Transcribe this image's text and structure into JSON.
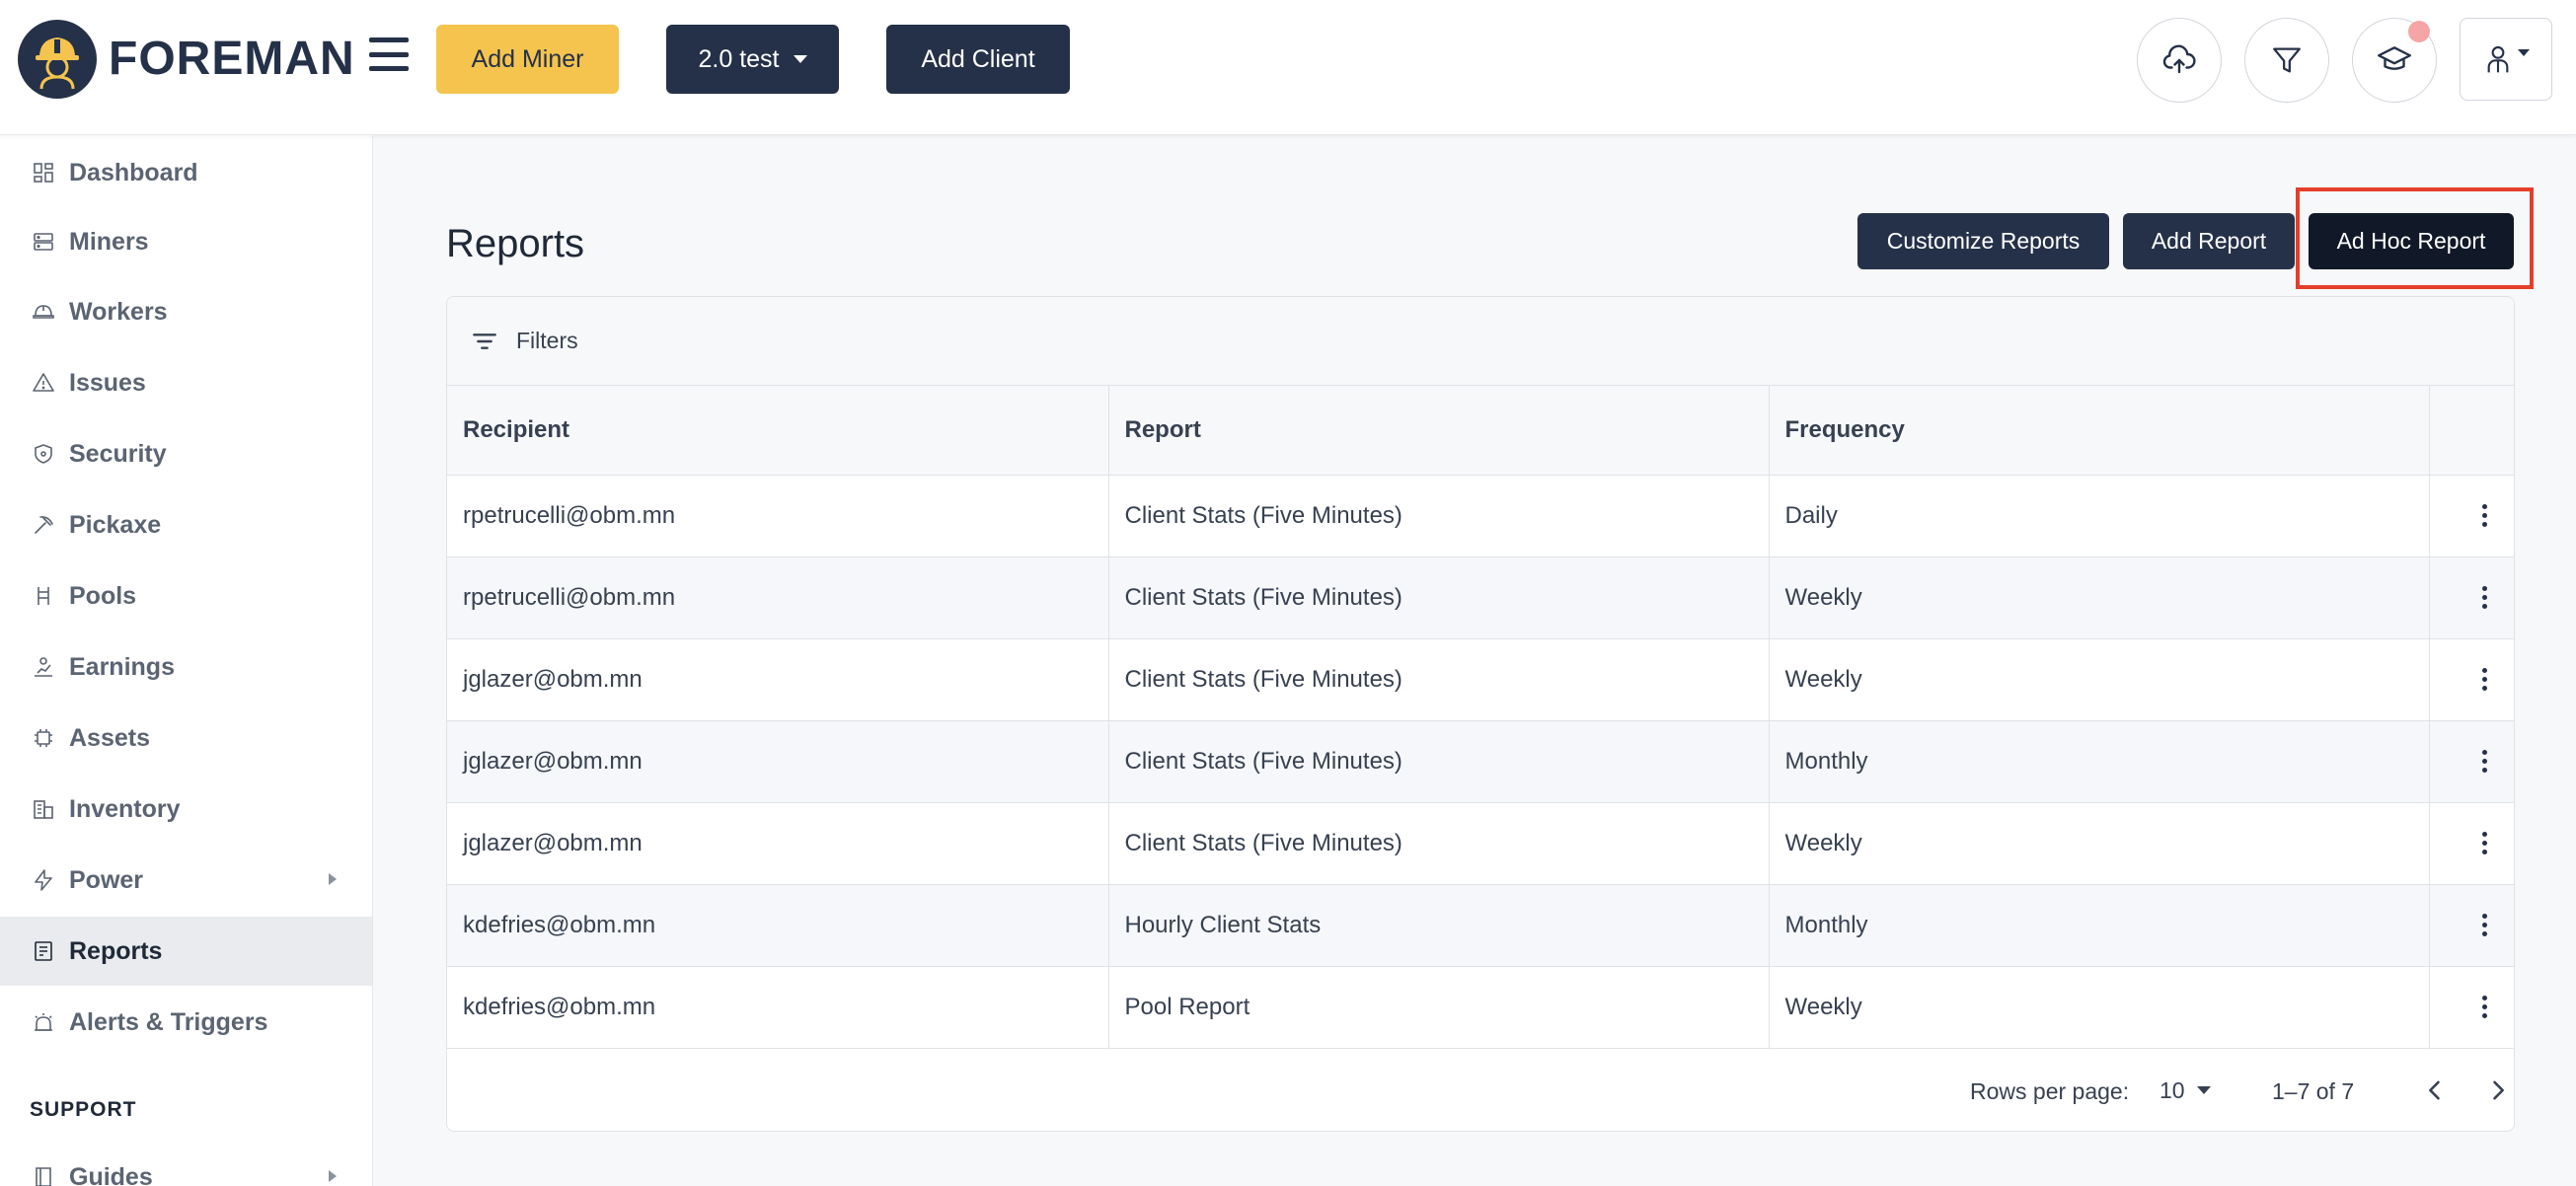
{
  "header": {
    "brand": "FOREMAN",
    "add_miner_label": "Add Miner",
    "site_selector_label": "2.0 test",
    "add_client_label": "Add Client",
    "icons": [
      "upload-cloud-icon",
      "filter-icon",
      "graduation-cap-icon",
      "user-icon"
    ]
  },
  "sidebar": {
    "items": [
      {
        "label": "Dashboard",
        "icon": "dashboard-icon"
      },
      {
        "label": "Miners",
        "icon": "server-icon"
      },
      {
        "label": "Workers",
        "icon": "hardhat-icon"
      },
      {
        "label": "Issues",
        "icon": "warning-triangle-icon"
      },
      {
        "label": "Security",
        "icon": "shield-icon"
      },
      {
        "label": "Pickaxe",
        "icon": "pickaxe-icon"
      },
      {
        "label": "Pools",
        "icon": "pools-icon"
      },
      {
        "label": "Earnings",
        "icon": "earnings-icon"
      },
      {
        "label": "Assets",
        "icon": "chip-icon"
      },
      {
        "label": "Inventory",
        "icon": "building-icon"
      },
      {
        "label": "Power",
        "icon": "lightning-icon"
      },
      {
        "label": "Reports",
        "icon": "report-icon"
      },
      {
        "label": "Alerts & Triggers",
        "icon": "alarm-icon"
      }
    ],
    "active": "Reports",
    "support_heading": "SUPPORT",
    "guides_label": "Guides"
  },
  "main": {
    "title": "Reports",
    "customize_label": "Customize Reports",
    "add_report_label": "Add Report",
    "ad_hoc_label": "Ad Hoc Report",
    "filters_label": "Filters",
    "table": {
      "headers": {
        "recipient": "Recipient",
        "report": "Report",
        "frequency": "Frequency"
      },
      "rows": [
        {
          "recipient": "rpetrucelli@obm.mn",
          "report": "Client Stats (Five Minutes)",
          "frequency": "Daily"
        },
        {
          "recipient": "rpetrucelli@obm.mn",
          "report": "Client Stats (Five Minutes)",
          "frequency": "Weekly"
        },
        {
          "recipient": "jglazer@obm.mn",
          "report": "Client Stats (Five Minutes)",
          "frequency": "Weekly"
        },
        {
          "recipient": "jglazer@obm.mn",
          "report": "Client Stats (Five Minutes)",
          "frequency": "Monthly"
        },
        {
          "recipient": "jglazer@obm.mn",
          "report": "Client Stats (Five Minutes)",
          "frequency": "Weekly"
        },
        {
          "recipient": "kdefries@obm.mn",
          "report": "Hourly Client Stats",
          "frequency": "Monthly"
        },
        {
          "recipient": "kdefries@obm.mn",
          "report": "Pool Report",
          "frequency": "Weekly"
        }
      ]
    },
    "pagination": {
      "rows_per_page_label": "Rows per page:",
      "rows_per_page": "10",
      "range": "1–7 of 7"
    }
  },
  "colors": {
    "brand_navy": "#253148",
    "accent_yellow": "#f5c44e",
    "highlight_red": "#e53e2a"
  }
}
